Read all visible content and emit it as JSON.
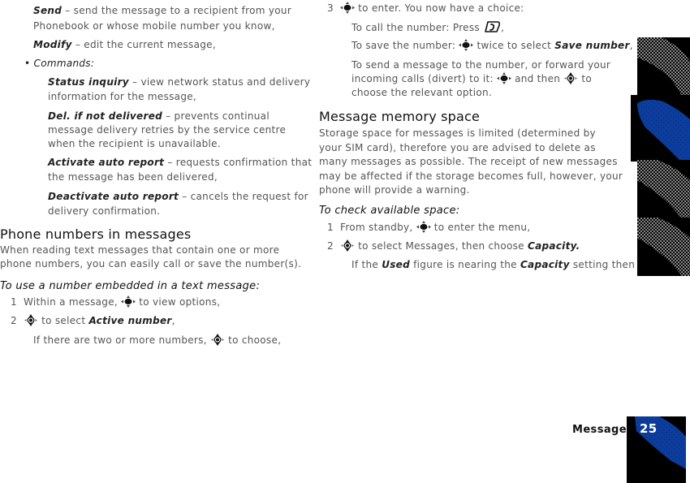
{
  "left_column": {
    "send": {
      "term": "Send",
      "text": " –  send the message to a recipient from your",
      "cont": "Phonebook or whose mobile number you know,"
    },
    "modify": {
      "term": "Modify",
      "text": " –  edit the current message,"
    },
    "commands": {
      "bullet": "•",
      "label": "Commands:"
    },
    "status_inquiry": {
      "term": "Status inquiry",
      "text": " –  view network status and delivery",
      "cont": "information for the message,"
    },
    "del_not_delivered": {
      "term": "Del. if not delivered",
      "text": " –  prevents continual",
      "cont1": "message delivery retries by the service centre",
      "cont2": "when the recipient is unavailable."
    },
    "activate": {
      "term": "Activate auto report",
      "text": " –  requests confirmation that",
      "cont": "the message has been delivered,"
    },
    "deactivate": {
      "term": "Deactivate auto report",
      "text": " –  cancels the request for",
      "cont": "delivery confirmation."
    },
    "phone_numbers": {
      "heading": "Phone numbers in messages",
      "body1": "When reading text messages that contain one or more",
      "body2": "phone numbers, you can easily call or save the number(s).",
      "lead": "To use a number embedded in a text message:",
      "step1": {
        "n": "1",
        "pre": "Within a message,",
        "post": " to view options,"
      },
      "step2": {
        "n": "2",
        "pre": "",
        "post": " to select ",
        "term": "Active number",
        "end": ","
      },
      "step2_note": {
        "pre": "If there are two or more numbers,",
        "post": " to choose,"
      }
    }
  },
  "right_column": {
    "step3": {
      "n": "3",
      "post": " to enter. You now have a choice:"
    },
    "call": {
      "pre": "To call the number: Press ",
      "end": ","
    },
    "save": {
      "pre": "To save the number:",
      "mid": " twice to select ",
      "term": "Save number",
      "end": ","
    },
    "send_fwd": {
      "line1": "To send a message to the number, or forward your",
      "pre": "incoming calls (divert) to it:",
      "mid": " and then ",
      "post": " to",
      "line3": "choose the relevant option."
    },
    "memory": {
      "heading": "Message memory space",
      "body": [
        "Storage space for messages is limited (determined by",
        "your SIM card), therefore you are advised to delete as",
        "many messages as possible. The receipt of new messages",
        "may be affected if the storage becomes full, however, your",
        "phone will provide a warning."
      ],
      "lead": "To check available space:",
      "step1": {
        "n": "1",
        "pre": "From standby,",
        "post": " to enter the menu,"
      },
      "step2": {
        "n": "2",
        "post": " to select Messages, then choose ",
        "term": "Capacity."
      },
      "note": {
        "pre": "If the ",
        "used": "Used",
        "mid": " figure is nearing the ",
        "capacity": "Capacity",
        "post": " setting then"
      }
    }
  },
  "footer": {
    "section": "Messages",
    "page": "25"
  },
  "icons": {
    "nav_key": "navigation-key-icon",
    "call_key": "call-key-icon"
  },
  "colors": {
    "tab_active": "#0a3a9a",
    "tab_inactive": "#888888",
    "tab_bg": "#000000",
    "text": "#555555"
  }
}
